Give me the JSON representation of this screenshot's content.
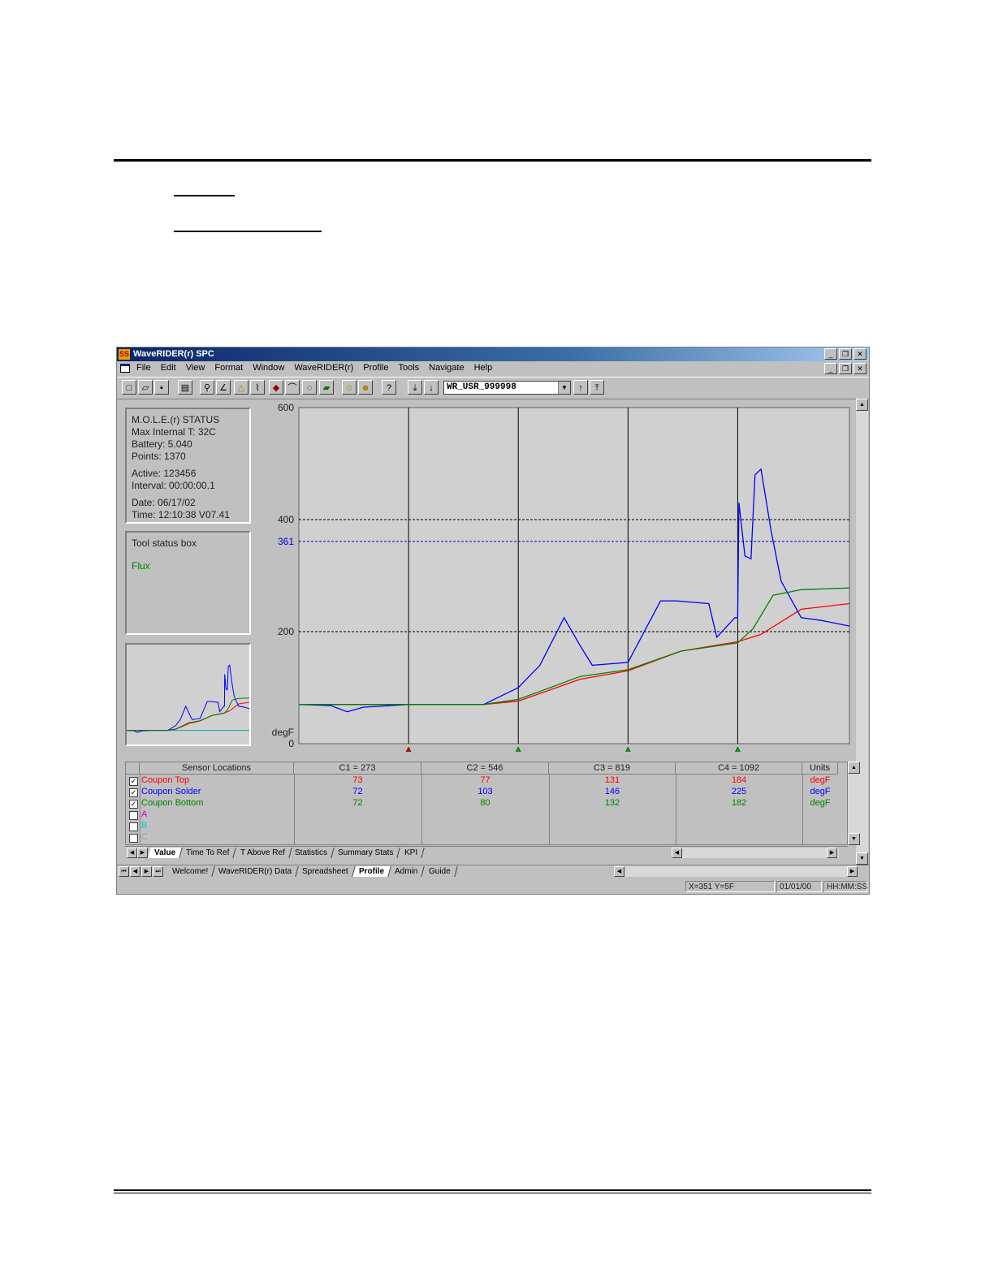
{
  "window": {
    "title": "WaveRIDER(r) SPC",
    "min": "_",
    "restore": "❐",
    "close": "✕"
  },
  "menu": [
    "File",
    "Edit",
    "View",
    "Format",
    "Window",
    "WaveRIDER(r)",
    "Profile",
    "Tools",
    "Navigate",
    "Help"
  ],
  "toolbar": {
    "profile_select": "WR_USR_999998"
  },
  "status_box": {
    "title": "M.O.L.E.(r) STATUS",
    "max_internal": "Max Internal T: 32C",
    "battery": "Battery: 5.040",
    "points": "Points: 1370",
    "active": "Active: 123456",
    "interval": "Interval: 00:00:00.1",
    "date": "Date: 06/17/02",
    "time": "Time: 12:10:38  V07.41"
  },
  "tool_status": {
    "title": "Tool status box",
    "flux": "Flux"
  },
  "chart_data": {
    "type": "line",
    "ylim": [
      0,
      600
    ],
    "yticks": [
      "600",
      "400",
      "361",
      "200",
      "0"
    ],
    "ylabel": "degF",
    "reference_lines": [
      400,
      361,
      200
    ],
    "cursors": [
      {
        "x": 273,
        "color": "#cc0000"
      },
      {
        "x": 546,
        "color": "#00aa00"
      },
      {
        "x": 819,
        "color": "#00aa00"
      },
      {
        "x": 1092,
        "color": "#00aa00"
      }
    ],
    "xlim": [
      0,
      1370
    ],
    "series": [
      {
        "name": "Coupon Top",
        "color": "#ff0000",
        "x": [
          0,
          273,
          460,
          546,
          700,
          819,
          950,
          1092,
          1150,
          1250,
          1370
        ],
        "y": [
          70,
          70,
          70,
          76,
          115,
          130,
          165,
          182,
          195,
          240,
          250
        ]
      },
      {
        "name": "Coupon Solder",
        "color": "#0000ff",
        "x": [
          0,
          80,
          120,
          160,
          273,
          460,
          546,
          600,
          660,
          700,
          730,
          819,
          900,
          940,
          1020,
          1040,
          1085,
          1092,
          1095,
          1110,
          1125,
          1135,
          1150,
          1175,
          1200,
          1250,
          1300,
          1370
        ],
        "y": [
          70,
          68,
          57,
          65,
          70,
          70,
          100,
          140,
          225,
          175,
          140,
          145,
          255,
          255,
          250,
          190,
          225,
          225,
          430,
          335,
          330,
          480,
          490,
          380,
          290,
          225,
          220,
          210
        ]
      },
      {
        "name": "Coupon Bottom",
        "color": "#008000",
        "x": [
          0,
          273,
          460,
          546,
          700,
          819,
          950,
          1092,
          1130,
          1180,
          1250,
          1370
        ],
        "y": [
          70,
          70,
          70,
          79,
          120,
          132,
          165,
          180,
          205,
          265,
          275,
          278
        ]
      }
    ]
  },
  "grid": {
    "headers": [
      "Sensor Locations",
      "C1 = 273",
      "C2 = 546",
      "C3 = 819",
      "C4 = 1092",
      "Units"
    ],
    "rows": [
      {
        "label": "Coupon Top",
        "checked": "✓",
        "color": "#ff0000",
        "values": [
          "73",
          "77",
          "131",
          "184"
        ],
        "unit": "degF"
      },
      {
        "label": "Coupon Solder",
        "checked": "✓",
        "color": "#0000ff",
        "values": [
          "72",
          "103",
          "146",
          "225"
        ],
        "unit": "degF"
      },
      {
        "label": "Coupon Bottom",
        "checked": "✓",
        "color": "#008000",
        "values": [
          "72",
          "80",
          "132",
          "182"
        ],
        "unit": "degF"
      },
      {
        "label": "A",
        "checked": "",
        "color": "#cc00cc",
        "values": [
          "",
          "",
          "",
          ""
        ],
        "unit": ""
      },
      {
        "label": "B",
        "checked": "",
        "color": "#00cccc",
        "values": [
          "",
          "",
          "",
          ""
        ],
        "unit": ""
      },
      {
        "label": "C",
        "checked": "",
        "color": "#a0a0a0",
        "values": [
          "",
          "",
          "",
          ""
        ],
        "unit": ""
      }
    ]
  },
  "grid_tabs": [
    "Value",
    "Time To Ref",
    "T Above Ref",
    "Statistics",
    "Summary Stats",
    "KPI"
  ],
  "doc_tabs": [
    "Welcome!",
    "WaveRIDER(r) Data",
    "Spreadsheet",
    "Profile",
    "Admin",
    "Guide"
  ],
  "statusbar": {
    "coords": "X=351 Y=5F",
    "date": "01/01/00",
    "time": "HH:MM:SS"
  }
}
